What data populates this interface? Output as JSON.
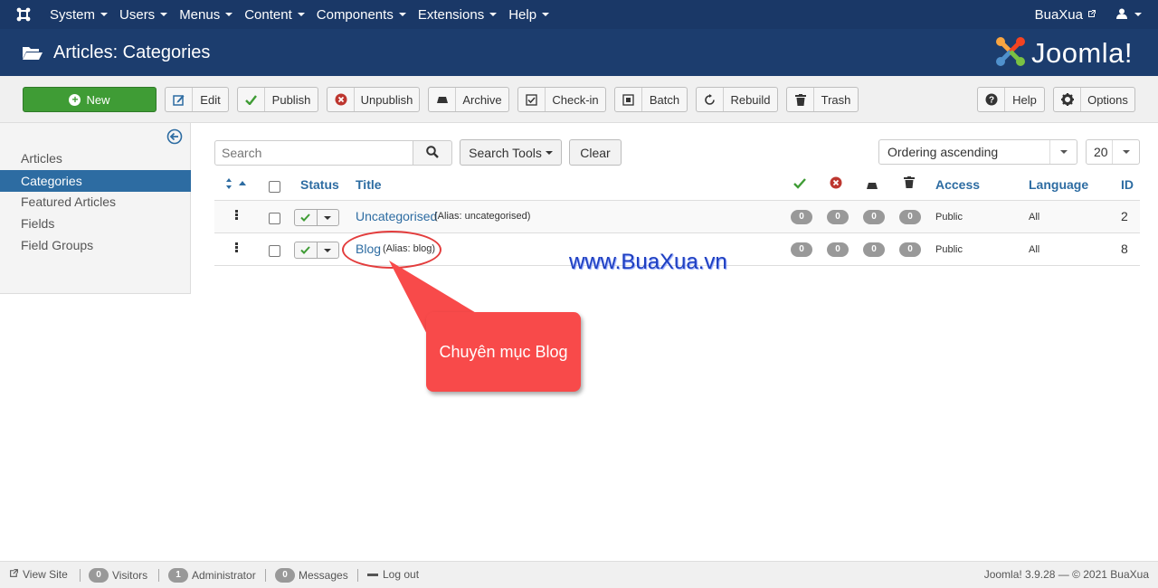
{
  "navbar": {
    "menus": [
      "System",
      "Users",
      "Menus",
      "Content",
      "Components",
      "Extensions",
      "Help"
    ],
    "site_name": "BuaXua"
  },
  "header": {
    "title": "Articles: Categories",
    "brand": "Joomla!"
  },
  "toolbar": {
    "new": "New",
    "edit": "Edit",
    "publish": "Publish",
    "unpublish": "Unpublish",
    "archive": "Archive",
    "checkin": "Check-in",
    "batch": "Batch",
    "rebuild": "Rebuild",
    "trash": "Trash",
    "help": "Help",
    "options": "Options"
  },
  "sidebar": {
    "items": [
      "Articles",
      "Categories",
      "Featured Articles",
      "Fields",
      "Field Groups"
    ],
    "active": "Categories"
  },
  "filters": {
    "search_placeholder": "Search",
    "search_tools": "Search Tools",
    "clear": "Clear",
    "ordering": "Ordering ascending",
    "limit": "20"
  },
  "table": {
    "headers": {
      "status": "Status",
      "title": "Title",
      "access": "Access",
      "language": "Language",
      "id": "ID"
    },
    "rows": [
      {
        "title": "Uncategorised",
        "alias": "(Alias: uncategorised)",
        "published": "0",
        "unpublished": "0",
        "archived": "0",
        "trashed": "0",
        "access": "Public",
        "language": "All",
        "id": "2"
      },
      {
        "title": "Blog",
        "alias": "(Alias: blog)",
        "published": "0",
        "unpublished": "0",
        "archived": "0",
        "trashed": "0",
        "access": "Public",
        "language": "All",
        "id": "8"
      }
    ]
  },
  "annotation": {
    "callout": "Chuyên mục Blog",
    "watermark": "www.BuaXua.vn"
  },
  "footer": {
    "view_site": "View Site",
    "visitors_count": "0",
    "visitors": "Visitors",
    "admin_count": "1",
    "administrator": "Administrator",
    "messages_count": "0",
    "messages": "Messages",
    "logout": "Log out",
    "version": "Joomla! 3.9.28 — © 2021 BuaXua"
  },
  "colors": {
    "navbar": "#1a3867",
    "header": "#1c3d6e",
    "new_button": "#3f9c35",
    "active_sidebar": "#2d6ca2",
    "link": "#2d6ca2",
    "callout": "#f84a4a"
  }
}
